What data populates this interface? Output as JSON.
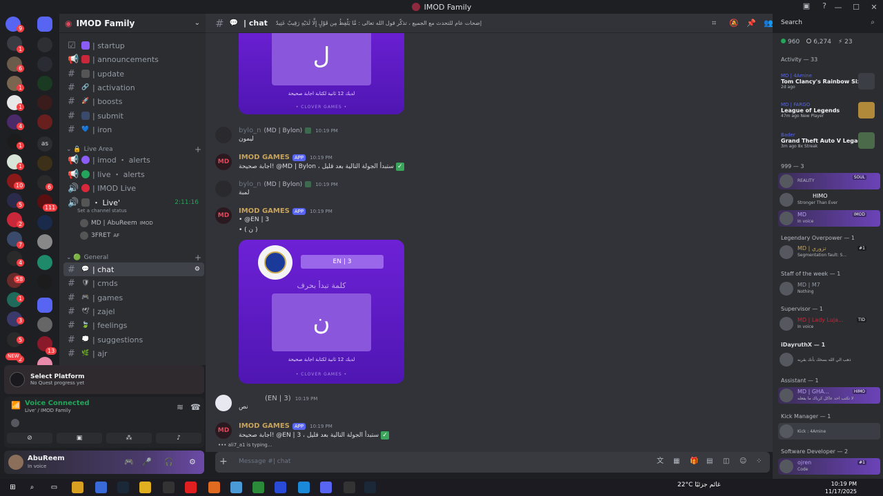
{
  "window": {
    "title": "IMOD Family"
  },
  "rail": {
    "badges": [
      "9",
      "1",
      "6",
      "1",
      "1",
      "4",
      "10",
      "6",
      "5",
      "111",
      "2",
      "7",
      "4",
      "58",
      "1",
      "3",
      "5",
      "2",
      "13"
    ],
    "new_label": "NEW",
    "as_label": "as"
  },
  "server": {
    "name": "IMOD Family"
  },
  "channels": [
    {
      "label": "| startup",
      "icon": "☑"
    },
    {
      "label": "| announcements",
      "icon": "📢"
    },
    {
      "label": "| update",
      "icon": "#"
    },
    {
      "label": "| activation",
      "icon": "#"
    },
    {
      "label": "| boosts",
      "icon": "#"
    },
    {
      "label": "| submit",
      "icon": "#"
    },
    {
      "label": "| iron",
      "icon": "#"
    }
  ],
  "categories": {
    "live": "Live Area",
    "general": "General"
  },
  "live_channels": [
    {
      "label": "| imod ・ alerts"
    },
    {
      "label": "| live ・ alerts"
    },
    {
      "label": "| IMOD Live"
    }
  ],
  "voice_channel": {
    "name": "・ Live'",
    "time": "2:11:16",
    "status": "Set a channel status",
    "users": [
      "MD | AbuReem",
      "3FRET"
    ],
    "user_tags": [
      "IMOD",
      "AF"
    ]
  },
  "general_channels": [
    {
      "label": "| chat"
    },
    {
      "label": "| cmds"
    },
    {
      "label": "| games"
    },
    {
      "label": "| zajel"
    },
    {
      "label": "| feelings"
    },
    {
      "label": "| suggestions"
    },
    {
      "label": "| ajr"
    }
  ],
  "quest": {
    "title": "Select Platform",
    "subtitle": "No Quest progress yet"
  },
  "voice": {
    "title": "Voice Connected",
    "subtitle": "Live' / IMOD Family"
  },
  "user": {
    "name": "AbuReem",
    "status": "In voice"
  },
  "chat": {
    "channel": "| chat",
    "topic": "إضحات عام للتحدث مع الجميع ، تذكّر قول الله تعالى : مَّا يَلْفِظُ مِن قَوْلٍ إِلَّا لَدَيْهِ رَقِيبٌ عَتِيدٌ",
    "letter1": "ل",
    "letter2": "ن",
    "clue": "لديك 12 ثانية لكتابة اجابة صحيحة",
    "brand": "• CLOVER GAMES •",
    "card_title": "كلمة تبدأ بحرف",
    "tag": "EN | 3",
    "messages": [
      {
        "user": "bylo_n",
        "role": "(MD | Bylon)",
        "time": "10:19 PM",
        "text": "ليمون"
      },
      {
        "user": "IMOD GAMES",
        "app": "APP",
        "time": "10:19 PM",
        "text": "اجابة صحيحة! @MD | Bylon ، ستبدأ الجولة التالية بعد قليل"
      },
      {
        "user": "bylo_n",
        "role": "(MD | Bylon)",
        "time": "10:19 PM",
        "text": "لمبة"
      },
      {
        "user": "IMOD GAMES",
        "app": "APP",
        "time": "10:19 PM",
        "text": "• @EN | 3",
        "text2": "• ( ن )"
      },
      {
        "user": "(EN | 3)",
        "time": "10:19 PM",
        "text": "نص"
      },
      {
        "user": "IMOD GAMES",
        "app": "APP",
        "time": "10:19 PM",
        "text": "اجابة صحيحة! @EN | 3 ، ستبدأ الجولة التالية بعد قليل"
      }
    ],
    "typing": "ali7_a1 is typing...",
    "placeholder": "Message #| chat"
  },
  "search": {
    "placeholder": "Search"
  },
  "members": {
    "stats": [
      "960",
      "6,274",
      "23"
    ],
    "activity_header": "Activity — 33",
    "activities": [
      {
        "user": "MD | 4Amine",
        "game": "Tom Clancy's Rainbow Six ...",
        "meta": "2d ago"
      },
      {
        "user": "MD | FARGO",
        "game": "League of Legends",
        "meta": "47m ago  New Player"
      },
      {
        "user": "Bader",
        "game": "Grand Theft Auto V Legacy",
        "meta": "3m ago  8x Streak"
      }
    ],
    "groups": [
      {
        "header": "999 — 3",
        "members": [
          {
            "name": "REALITY",
            "tag": "SOUL",
            "status": ""
          },
          {
            "name": "HIMO",
            "tag": "",
            "status": "Stronger Than Ever"
          },
          {
            "name": "MD",
            "tag": "IMOD",
            "status": "In voice"
          }
        ]
      },
      {
        "header": "Legendary Overpower — 1",
        "members": [
          {
            "name": "MD | تزوري",
            "tag": "#1",
            "status": "Segmentation fault: S..."
          }
        ]
      },
      {
        "header": "Staff of the week — 1",
        "members": [
          {
            "name": "MD | M7",
            "tag": "",
            "status": "Nothing"
          }
        ]
      },
      {
        "header": "Supervisor — 1",
        "members": [
          {
            "name": "MD | Lady Luja...",
            "tag": "TID",
            "status": "In voice"
          }
        ]
      },
      {
        "header": "iDayruthX — 1",
        "members": [
          {
            "name": "",
            "tag": "",
            "status": "ذهب الي الله بسخك بأنك بقربه"
          }
        ]
      },
      {
        "header": "Assistant — 1",
        "members": [
          {
            "name": "MD | GHA...",
            "tag": "HIMO",
            "status": "لا تكتب احد عاكل كرياك ما يفعله"
          }
        ]
      },
      {
        "header": "Kick Manager — 1",
        "members": [
          {
            "name": "",
            "tag": "",
            "status": "Kick : 4Amine"
          }
        ]
      },
      {
        "header": "Software Developer — 2",
        "members": [
          {
            "name": "ojren",
            "tag": "#1",
            "status": "Code"
          }
        ]
      }
    ]
  },
  "taskbar": {
    "weather": "22°C  غائم جزئيًا",
    "time": "10:19 PM",
    "date": "11/17/2025"
  }
}
